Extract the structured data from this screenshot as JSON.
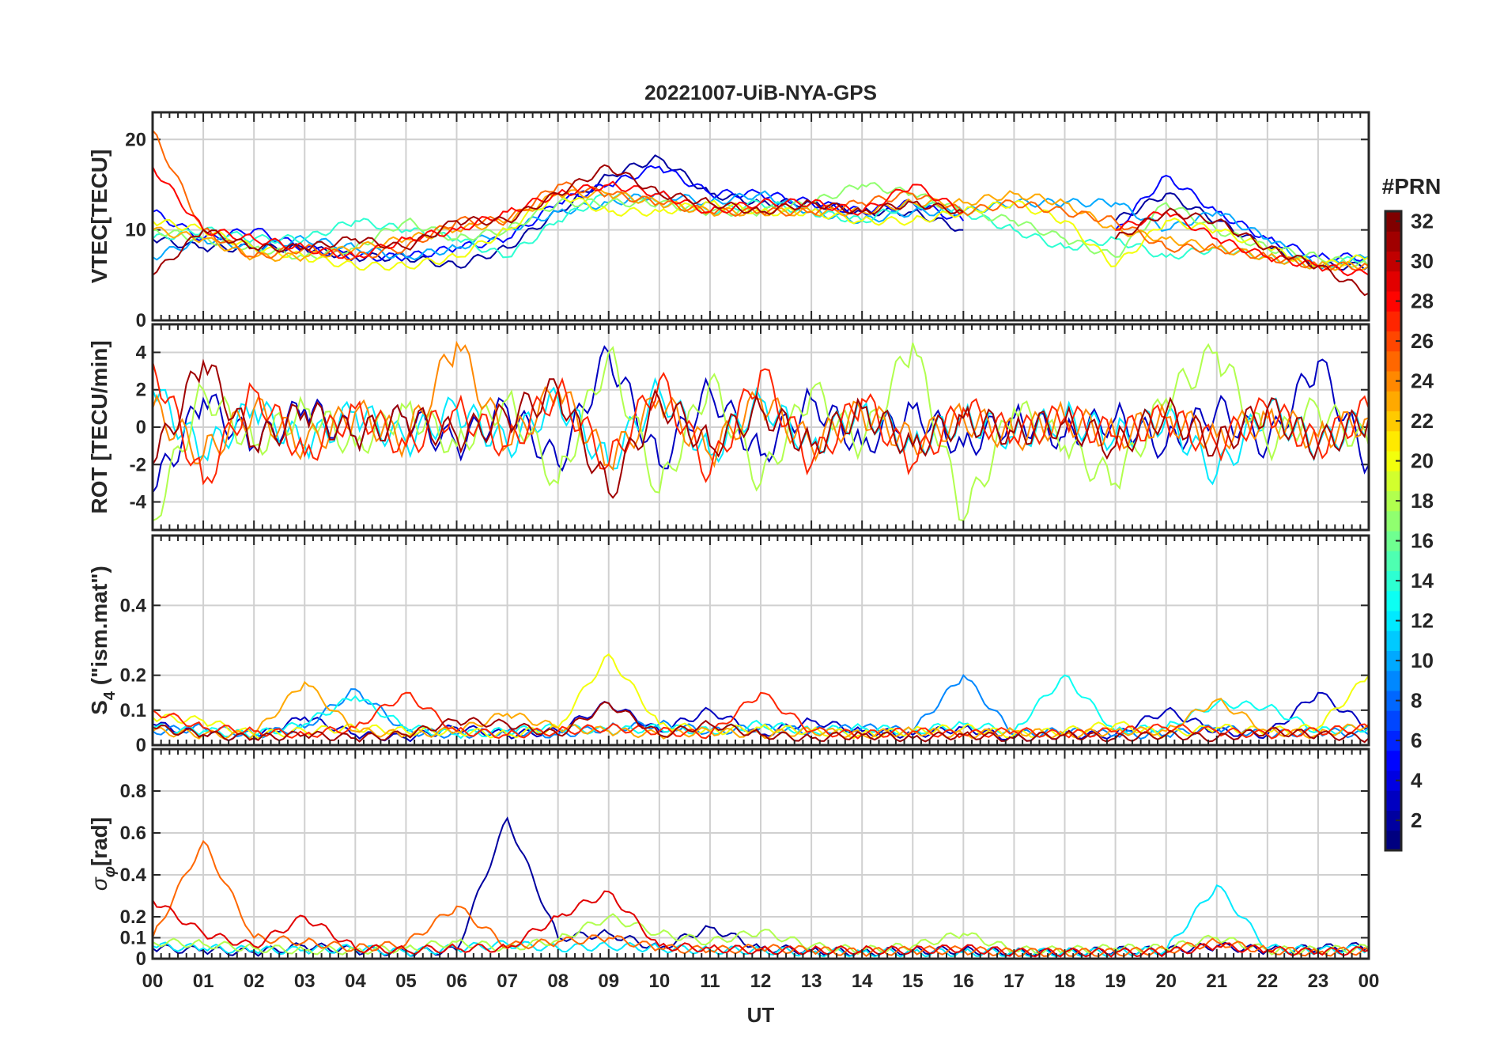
{
  "chart_data": {
    "type": "line",
    "title": "20221007-UiB-NYA-GPS",
    "xlabel": "UT",
    "xlim": [
      0,
      24
    ],
    "x_tick_labels": [
      "00",
      "01",
      "02",
      "03",
      "04",
      "05",
      "06",
      "07",
      "08",
      "09",
      "10",
      "11",
      "12",
      "13",
      "14",
      "15",
      "16",
      "17",
      "18",
      "19",
      "20",
      "21",
      "22",
      "23",
      "00"
    ],
    "grid": true,
    "colorbar": {
      "label": "#PRN",
      "colormap": "jet",
      "range": [
        1,
        32
      ],
      "ticks": [
        "2",
        "4",
        "6",
        "8",
        "10",
        "12",
        "14",
        "16",
        "18",
        "20",
        "22",
        "24",
        "26",
        "28",
        "30",
        "32"
      ],
      "placement": "right"
    },
    "x": [
      0,
      1,
      2,
      3,
      4,
      5,
      6,
      7,
      8,
      9,
      10,
      11,
      12,
      13,
      14,
      15,
      16,
      17,
      18,
      19,
      20,
      21,
      22,
      23,
      24
    ],
    "panels": [
      {
        "ylabel": "VTEC[TECU]",
        "ylim": [
          0,
          23
        ],
        "y_ticks": [
          "0",
          "10",
          "20"
        ],
        "series": [
          {
            "prn": 2,
            "values": [
              9,
              8,
              8,
              8,
              7,
              7,
              6,
              8,
              12,
              16,
              18,
              14,
              13,
              13,
              12,
              12,
              10,
              null,
              null,
              11,
              14,
              11,
              8,
              6,
              6
            ]
          },
          {
            "prn": 5,
            "values": [
              12,
              9,
              10,
              8,
              7,
              7,
              8,
              9,
              13,
              15,
              17,
              14,
              14,
              13,
              12,
              13,
              11,
              null,
              null,
              10,
              16,
              12,
              9,
              7,
              7
            ]
          },
          {
            "prn": 10,
            "values": [
              7,
              9,
              8,
              9,
              8,
              7,
              8,
              10,
              12,
              13,
              14,
              13,
              14,
              12,
              11,
              12,
              12,
              13,
              13,
              13,
              10,
              12,
              9,
              6,
              7
            ]
          },
          {
            "prn": 14,
            "values": [
              9,
              10,
              9,
              9,
              11,
              10,
              9,
              7,
              11,
              14,
              13,
              12,
              13,
              12,
              11,
              13,
              12,
              10,
              8,
              9,
              7,
              8,
              7,
              6,
              7
            ]
          },
          {
            "prn": 17,
            "values": [
              10,
              9,
              8,
              7,
              8,
              11,
              9,
              10,
              13,
              13,
              13,
              12,
              12,
              13,
              15,
              14,
              12,
              11,
              9,
              7,
              13,
              10,
              8,
              7,
              6
            ]
          },
          {
            "prn": 20,
            "values": [
              11,
              10,
              8,
              7,
              6,
              6,
              7,
              10,
              14,
              12,
              12,
              13,
              12,
              12,
              11,
              11,
              12,
              13,
              11,
              6,
              11,
              10,
              8,
              6,
              7
            ]
          },
          {
            "prn": 23,
            "values": [
              10,
              9,
              7,
              7,
              8,
              9,
              10,
              11,
              14,
              14,
              13,
              12,
              12,
              12,
              12,
              13,
              13,
              14,
              13,
              10,
              9,
              8,
              7,
              6,
              6
            ]
          },
          {
            "prn": 25,
            "values": [
              21,
              10,
              7,
              8,
              7,
              8,
              11,
              11,
              15,
              14,
              13,
              12,
              12,
              12,
              13,
              14,
              12,
              13,
              12,
              11,
              8,
              8,
              7,
              6,
              6
            ]
          },
          {
            "prn": 28,
            "values": [
              17,
              10,
              9,
              8,
              7,
              9,
              10,
              12,
              14,
              15,
              14,
              12,
              13,
              13,
              12,
              15,
              12,
              null,
              null,
              10,
              12,
              9,
              7,
              6,
              5
            ]
          },
          {
            "prn": 31,
            "values": [
              5,
              10,
              8,
              8,
              9,
              8,
              11,
              11,
              14,
              17,
              14,
              13,
              12,
              13,
              12,
              13,
              12,
              null,
              null,
              9,
              12,
              11,
              8,
              6,
              3
            ]
          }
        ]
      },
      {
        "ylabel": "ROT [TECU/min]",
        "ylim": [
          -5.5,
          5.5
        ],
        "y_ticks": [
          "-4",
          "-2",
          "0",
          "2",
          "4"
        ],
        "series": [
          {
            "prn": 3,
            "values": [
              -3.5,
              1.5,
              -1,
              1,
              -0.5,
              0.5,
              -1,
              1,
              -2,
              4,
              -2,
              2,
              -1.5,
              1.5,
              -1,
              1,
              -1,
              0.5,
              -0.5,
              0.5,
              -1,
              1,
              -1,
              3.5,
              -2
            ]
          },
          {
            "prn": 12,
            "values": [
              2,
              -1.5,
              1,
              -1,
              0.8,
              -0.8,
              1,
              -1,
              1.5,
              -2,
              2,
              -1.5,
              1.5,
              -1,
              1,
              -1,
              0.5,
              -0.5,
              0.5,
              -0.5,
              0.5,
              -2.5,
              1,
              -1,
              0.5
            ]
          },
          {
            "prn": 18,
            "values": [
              -5,
              2,
              -1,
              1,
              -1,
              1,
              -1,
              1.5,
              -3,
              4,
              -3.5,
              2.5,
              -3,
              2,
              -1,
              4.5,
              -5,
              1,
              -1,
              -3,
              1.5,
              4,
              -1,
              1,
              -1
            ]
          },
          {
            "prn": 24,
            "values": [
              1,
              -1.5,
              1,
              -1,
              0.8,
              -0.8,
              4.5,
              -1,
              2,
              -2,
              1.5,
              -1.5,
              1.5,
              -1,
              0.8,
              -0.8,
              0.5,
              -0.5,
              0.5,
              -0.5,
              0.5,
              -0.5,
              0.5,
              -0.5,
              0.5
            ]
          },
          {
            "prn": 27,
            "values": [
              3.5,
              -3,
              2,
              -1.5,
              1,
              -1,
              1,
              -1,
              2,
              -2,
              2.5,
              -2.5,
              3,
              -2,
              1.5,
              -2,
              1,
              -0.5,
              0.5,
              -0.5,
              0.5,
              -1,
              1,
              -1,
              1
            ]
          },
          {
            "prn": 31,
            "values": [
              -2,
              3.5,
              -1,
              0.8,
              -0.5,
              0.5,
              -0.5,
              0.5,
              2,
              -3.5,
              1.5,
              -1,
              1,
              -1,
              1,
              -1,
              0.5,
              -0.3,
              0.3,
              -1,
              0.8,
              -1,
              1,
              -1,
              0.5
            ]
          }
        ]
      },
      {
        "ylabel": "S4 (\"ism.mat\")",
        "ylabel_main": "S",
        "ylabel_sub": "4",
        "ylabel_rest": " (\"ism.mat\")",
        "ylim": [
          0,
          0.6
        ],
        "y_ticks": [
          "0",
          "0.1",
          "0.2",
          "0.4"
        ],
        "series": [
          {
            "prn": 3,
            "values": [
              0.06,
              0.03,
              0.02,
              0.08,
              0.03,
              0.02,
              0.05,
              0.03,
              0.04,
              0.12,
              0.04,
              0.1,
              0.03,
              0.07,
              0.04,
              0.03,
              0.05,
              0.02,
              0.03,
              0.03,
              0.1,
              0.04,
              0.03,
              0.15,
              0.05
            ]
          },
          {
            "prn": 9,
            "values": [
              0.04,
              0.05,
              0.03,
              0.05,
              0.16,
              0.04,
              0.03,
              0.04,
              0.03,
              0.05,
              0.06,
              0.04,
              0.05,
              0.04,
              0.05,
              0.04,
              0.2,
              0.03,
              0.04,
              0.03,
              0.03,
              0.05,
              0.03,
              0.04,
              0.03
            ]
          },
          {
            "prn": 13,
            "values": [
              0.05,
              0.04,
              0.03,
              0.06,
              0.14,
              0.05,
              0.03,
              0.04,
              0.05,
              0.04,
              0.05,
              0.04,
              0.06,
              0.04,
              0.05,
              0.04,
              0.06,
              0.04,
              0.2,
              0.04,
              0.05,
              0.12,
              0.11,
              0.04,
              0.05
            ]
          },
          {
            "prn": 20,
            "values": [
              0.08,
              0.07,
              0.03,
              0.04,
              0.05,
              0.04,
              0.04,
              0.03,
              0.05,
              0.26,
              0.06,
              0.04,
              0.05,
              0.04,
              0.03,
              0.04,
              0.05,
              0.03,
              0.04,
              0.06,
              0.03,
              0.05,
              0.04,
              0.05,
              0.2
            ]
          },
          {
            "prn": 23,
            "values": [
              0.04,
              0.03,
              0.03,
              0.18,
              0.04,
              0.03,
              0.04,
              0.09,
              0.05,
              0.04,
              0.03,
              0.04,
              0.03,
              0.04,
              0.03,
              0.04,
              0.03,
              0.04,
              0.03,
              0.04,
              0.04,
              0.13,
              0.04,
              0.03,
              0.06
            ]
          },
          {
            "prn": 27,
            "values": [
              0.1,
              0.05,
              0.04,
              0.03,
              0.05,
              0.15,
              0.04,
              0.03,
              0.04,
              0.05,
              0.04,
              0.03,
              0.15,
              0.04,
              0.03,
              0.04,
              0.03,
              0.04,
              0.03,
              0.04,
              0.05,
              0.04,
              0.03,
              0.04,
              0.05
            ]
          },
          {
            "prn": 31,
            "values": [
              0.05,
              0.03,
              0.02,
              0.03,
              0.02,
              0.03,
              0.07,
              0.06,
              0.03,
              0.12,
              0.03,
              0.06,
              0.03,
              0.02,
              0.03,
              0.02,
              0.03,
              0.02,
              0.03,
              0.02,
              0.03,
              0.02,
              0.04,
              0.03,
              0.02
            ]
          }
        ]
      },
      {
        "ylabel": "σφ[rad]",
        "ylabel_main": "σ",
        "ylabel_sub": "φ",
        "ylabel_rest": "[rad]",
        "ylim": [
          0,
          1
        ],
        "y_ticks": [
          "0",
          "0.1",
          "0.2",
          "0.4",
          "0.6",
          "0.8"
        ],
        "series": [
          {
            "prn": 2,
            "values": [
              0.05,
              0.04,
              0.03,
              0.06,
              0.04,
              0.03,
              0.04,
              0.67,
              0.1,
              0.12,
              0.05,
              0.15,
              0.05,
              0.04,
              0.03,
              0.04,
              0.04,
              0.03,
              0.03,
              0.04,
              0.04,
              0.06,
              0.04,
              0.05,
              0.06
            ]
          },
          {
            "prn": 12,
            "values": [
              0.06,
              0.05,
              0.04,
              0.04,
              0.05,
              0.03,
              0.05,
              0.07,
              0.05,
              0.06,
              0.05,
              0.04,
              0.04,
              0.03,
              0.03,
              0.03,
              0.03,
              0.03,
              0.03,
              0.03,
              0.04,
              0.35,
              0.05,
              0.04,
              0.05
            ]
          },
          {
            "prn": 18,
            "values": [
              0.08,
              0.07,
              0.05,
              0.04,
              0.04,
              0.05,
              0.08,
              0.05,
              0.09,
              0.2,
              0.12,
              0.08,
              0.13,
              0.06,
              0.04,
              0.06,
              0.12,
              0.04,
              0.04,
              0.05,
              0.05,
              0.1,
              0.04,
              0.04,
              0.05
            ]
          },
          {
            "prn": 25,
            "values": [
              0.1,
              0.56,
              0.1,
              0.08,
              0.05,
              0.07,
              0.25,
              0.06,
              0.08,
              0.1,
              0.05,
              0.04,
              0.05,
              0.04,
              0.03,
              0.04,
              0.04,
              0.03,
              0.03,
              0.03,
              0.04,
              0.08,
              0.04,
              0.03,
              0.04
            ]
          },
          {
            "prn": 29,
            "values": [
              0.28,
              0.12,
              0.06,
              0.2,
              0.05,
              0.04,
              0.05,
              0.05,
              0.2,
              0.32,
              0.06,
              0.05,
              0.04,
              0.04,
              0.04,
              0.04,
              0.05,
              0.03,
              0.03,
              0.03,
              0.03,
              0.06,
              0.04,
              0.03,
              0.04
            ]
          }
        ]
      }
    ]
  }
}
